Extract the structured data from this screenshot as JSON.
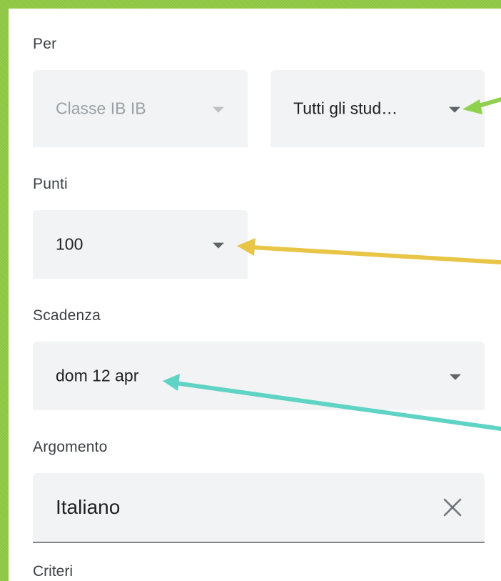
{
  "form": {
    "for_label": "Per",
    "class_select": {
      "value": "Classe IB IB",
      "disabled": true
    },
    "students_select": {
      "value": "Tutti gli stud…"
    },
    "points_label": "Punti",
    "points_select": {
      "value": "100"
    },
    "due_label": "Scadenza",
    "due_select": {
      "value": "dom 12 apr"
    },
    "topic_label": "Argomento",
    "topic_field": {
      "value": "Italiano"
    },
    "next_label": "Criteri"
  },
  "icons": {
    "dropdown": "caret-down-icon",
    "clear": "close-icon"
  },
  "annotation_colors": {
    "background": "#8cc63f",
    "arrow_students": "#8fd14f",
    "arrow_points": "#e8c547",
    "arrow_due": "#5fd3c4"
  }
}
